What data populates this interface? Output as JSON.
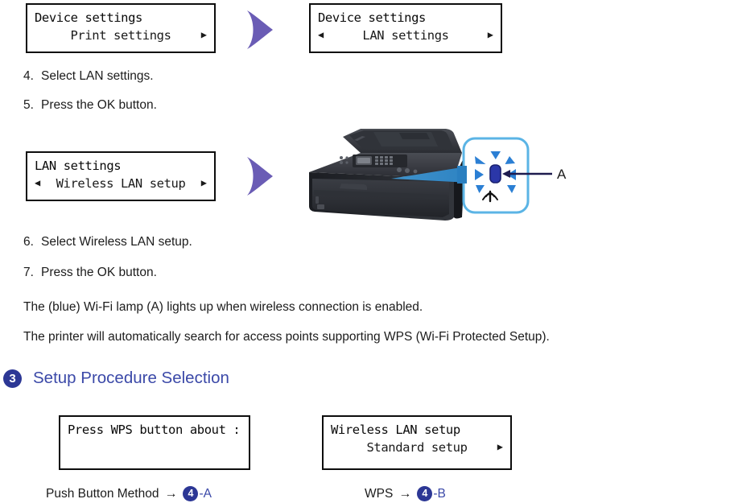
{
  "lcd_panels": {
    "device_settings_print": {
      "line1": "Device settings",
      "line2": "Print settings",
      "left_caret": "",
      "right_caret": "▶"
    },
    "device_settings_lan": {
      "line1": "Device settings",
      "line2": "LAN settings",
      "left_caret": "◀",
      "right_caret": "▶"
    },
    "lan_settings_wireless": {
      "line1": "LAN settings",
      "line2": "Wireless LAN setup",
      "left_caret": "◀",
      "right_caret": "▶"
    },
    "wps_press_button": {
      "line1": "Press WPS button about :",
      "line2": "",
      "left_caret": "",
      "right_caret": ""
    },
    "wireless_lan_setup_standard": {
      "line1": "Wireless LAN setup",
      "line2": "Standard setup",
      "left_caret": "",
      "right_caret": "▶"
    }
  },
  "steps": {
    "step4": {
      "number": "4.",
      "text": "Select LAN settings."
    },
    "step5": {
      "number": "5.",
      "text": "Press the OK button."
    },
    "step6": {
      "number": "6.",
      "text": "Select Wireless LAN setup."
    },
    "step7": {
      "number": "7.",
      "text": "Press the OK button."
    }
  },
  "paragraphs": {
    "lamp": "The (blue) Wi-Fi lamp (A) lights up when wireless connection is enabled.",
    "search": "The printer will automatically search for access points supporting WPS (Wi-Fi Protected Setup)."
  },
  "section": {
    "badge": "3",
    "title": "Setup Procedure Selection"
  },
  "captions": {
    "push_button": {
      "label": "Push Button Method",
      "arrow": "→",
      "badge": "4",
      "suffix": "-A"
    },
    "wps": {
      "label": "WPS",
      "arrow": "→",
      "badge": "4",
      "suffix": "-B"
    }
  },
  "printer_figure": {
    "callout_label": "A",
    "lamp_color": "#2b37a8",
    "callout_border_color": "#5bb4e5",
    "pointer_color": "#2a7fc0"
  },
  "colors": {
    "heading_blue": "#3b49a8",
    "badge_navy": "#2c3795",
    "arrow_purple": "#6a5cb5",
    "lcd_border": "#0d0d0d"
  }
}
